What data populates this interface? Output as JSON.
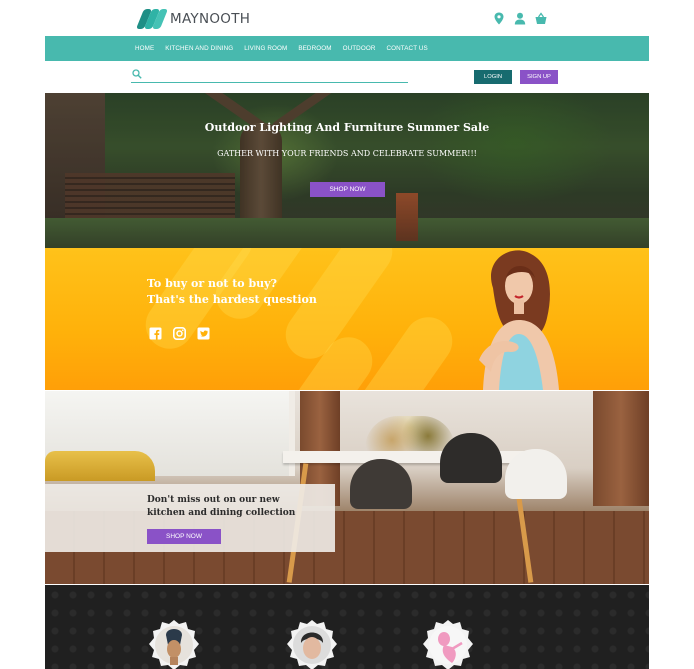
{
  "header": {
    "brand": "MAYNOOTH",
    "icons": [
      "location-pin-icon",
      "user-icon",
      "basket-icon"
    ]
  },
  "nav": {
    "items": [
      "HOME",
      "KITCHEN AND DINING",
      "LIVING ROOM",
      "BEDROOM",
      "OUTDOOR",
      "CONTACT US"
    ]
  },
  "search": {
    "placeholder": ""
  },
  "auth": {
    "login": "LOGIN",
    "signup": "SIGN UP"
  },
  "hero": {
    "title": "Outdoor Lighting And Furniture Summer Sale",
    "subtitle": "GATHER WITH YOUR FRIENDS AND CELEBRATE SUMMER!!!",
    "cta": "SHOP NOW"
  },
  "promo": {
    "line1": "To buy or not to buy?",
    "line2": "That's the hardest question",
    "social": [
      "facebook-icon",
      "instagram-icon",
      "twitter-icon"
    ]
  },
  "dining": {
    "line1": "Don't miss out on our new",
    "line2": "kitchen and dining collection",
    "cta": "SHOP NOW"
  },
  "colors": {
    "teal": "#48b9ae",
    "dark_teal": "#176b6f",
    "purple": "#8a52c7",
    "yellow": "#ffb10a"
  }
}
